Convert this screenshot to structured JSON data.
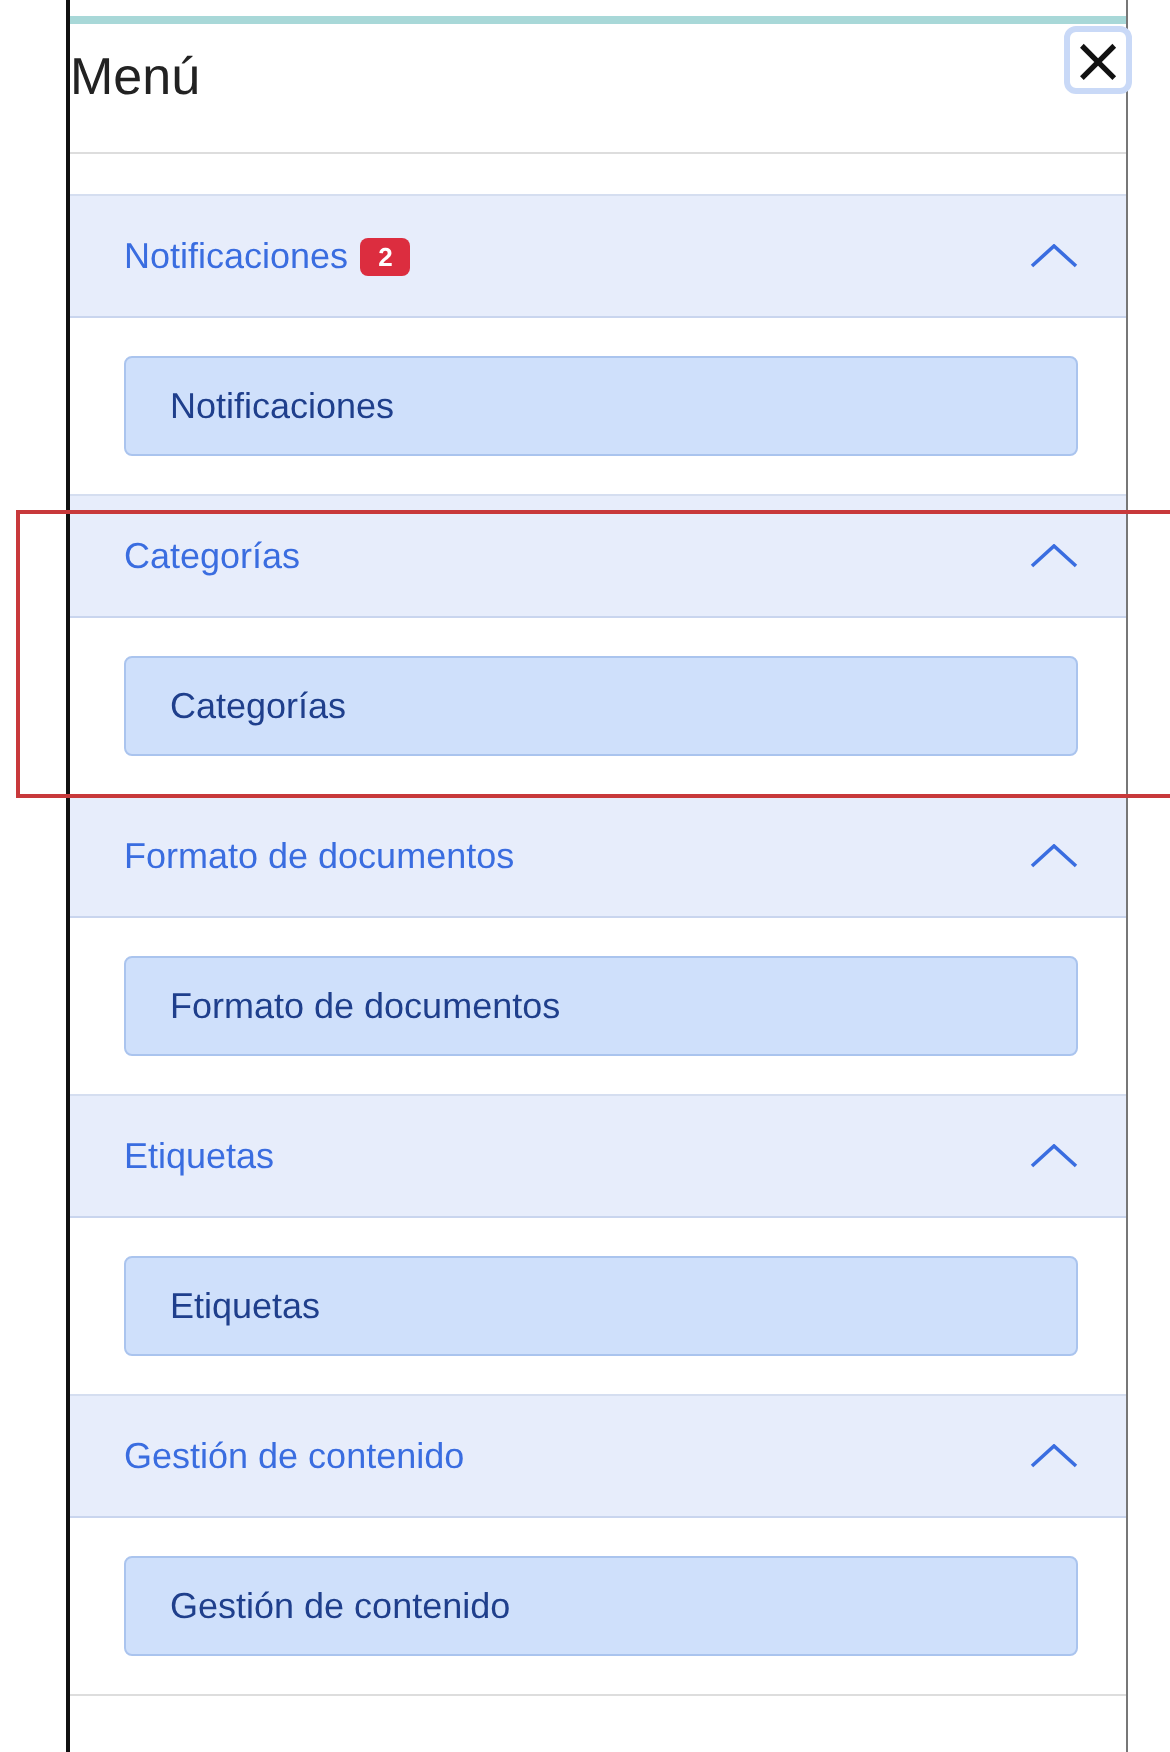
{
  "title": "Menú",
  "close_button": {
    "label": "×"
  },
  "sections": [
    {
      "title": "Notificaciones",
      "badge": "2",
      "expanded": true,
      "highlighted": false,
      "items": [
        "Notificaciones"
      ]
    },
    {
      "title": "Categorías",
      "expanded": true,
      "highlighted": true,
      "items": [
        "Categorías"
      ]
    },
    {
      "title": "Formato de documentos",
      "expanded": true,
      "highlighted": false,
      "items": [
        "Formato de documentos"
      ]
    },
    {
      "title": "Etiquetas",
      "expanded": true,
      "highlighted": false,
      "items": [
        "Etiquetas"
      ]
    },
    {
      "title": "Gestión de contenido",
      "expanded": true,
      "highlighted": false,
      "items": [
        "Gestión de contenido"
      ]
    }
  ]
}
